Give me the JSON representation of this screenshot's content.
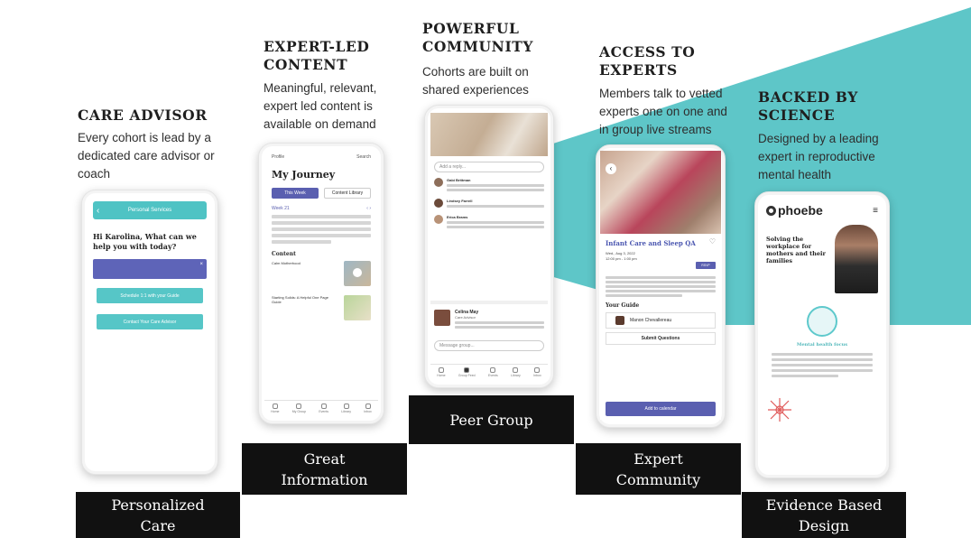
{
  "colors": {
    "teal": "#5ec6c8",
    "step_black": "#111111",
    "purple": "#5a5fb0"
  },
  "columns": [
    {
      "heading": "CARE ADVISOR",
      "description": "Every cohort is lead by a dedicated care advisor or coach",
      "step": "Personalized Care"
    },
    {
      "heading": "EXPERT-LED CONTENT",
      "description": "Meaningful, relevant, expert led content is available on demand",
      "step": "Great Information"
    },
    {
      "heading": "POWERFUL COMMUNITY",
      "description": "Cohorts are built on shared experiences",
      "step": "Peer Group"
    },
    {
      "heading": "ACCESS TO EXPERTS",
      "description": "Members talk to vetted experts one on one and in group live streams",
      "step": "Expert Community"
    },
    {
      "heading": "BACKED BY SCIENCE",
      "description": "Designed by a leading expert in reproductive mental health",
      "step": "Evidence Based Design"
    }
  ],
  "phone1": {
    "header": "Personal Services",
    "greeting": "Hi Karolina, What can we help you with today?",
    "button1": "Schedule 1:1 with your Guide",
    "button2": "Contact Your Care Advisor"
  },
  "phone2": {
    "profile": "Profile",
    "search": "Search",
    "title": "My Journey",
    "tab_active": "This Week",
    "tab_other": "Content Library",
    "week": "Week 21",
    "content_heading": "Content",
    "item1": "Calm Motherhood",
    "item2": "Starting Solids: A Helpful One Page Guide",
    "nav": [
      "Home",
      "My Group",
      "Events",
      "Library",
      "Inbox"
    ]
  },
  "phone3": {
    "reply_placeholder": "Add a reply...",
    "commenters": [
      "Gabi Brittman",
      "Lindsey Farrell",
      "Erica Brams"
    ],
    "post_author": "Celina May",
    "post_role": "Care Advisor",
    "message_placeholder": "Message group...",
    "nav": [
      "Home",
      "Group Feed",
      "Events",
      "Library",
      "Inbox"
    ]
  },
  "phone4": {
    "title": "Infant Care and Sleep QA",
    "date": "Wed., Aug 3, 2022",
    "time": "12:00 pm - 1:00 pm",
    "rsvp": "RSVP",
    "guide_heading": "Your Guide",
    "guide_name": "Manon Chevallereau",
    "submit": "Submit Questions",
    "calendar": "Add to calendar"
  },
  "phone5": {
    "logo": "phoebe",
    "hero": "Solving the workplace for mothers and their families",
    "subheading": "Mental health focus"
  }
}
